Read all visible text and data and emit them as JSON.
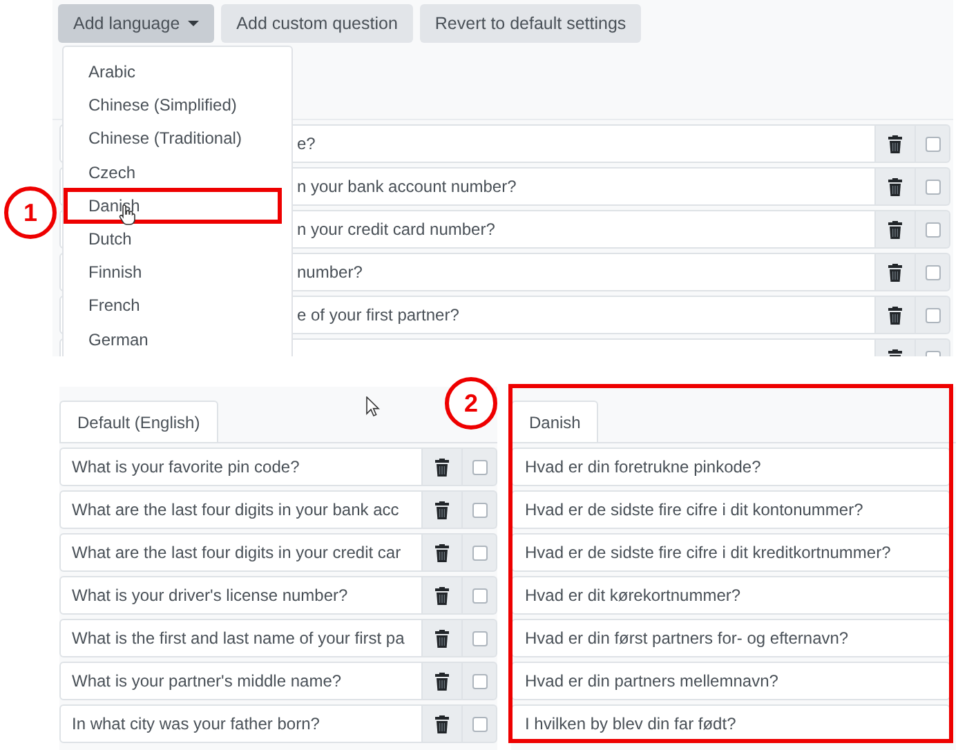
{
  "top_screen": {
    "buttons": [
      {
        "label": "Add language",
        "kind": "dropdown",
        "selected": true
      },
      {
        "label": "Add custom question",
        "kind": "plain",
        "selected": false
      },
      {
        "label": "Revert to default settings",
        "kind": "plain",
        "selected": false
      }
    ],
    "language_menu": {
      "items": [
        {
          "label": "Arabic",
          "selected": false
        },
        {
          "label": "Chinese (Simplified)",
          "selected": false
        },
        {
          "label": "Chinese (Traditional)",
          "selected": false
        },
        {
          "label": "Czech",
          "selected": false
        },
        {
          "label": "Danish",
          "selected": true
        },
        {
          "label": "Dutch",
          "selected": false
        },
        {
          "label": "Finnish",
          "selected": false
        },
        {
          "label": "French",
          "selected": false
        },
        {
          "label": "German",
          "selected": false
        }
      ]
    },
    "rows": [
      {
        "question": "e?",
        "checked": false
      },
      {
        "question": "n your bank account number?",
        "checked": false
      },
      {
        "question": "n your credit card number?",
        "checked": false
      },
      {
        "question": "number?",
        "checked": false
      },
      {
        "question": "e of your first partner?",
        "checked": false
      },
      {
        "checked": false
      }
    ]
  },
  "bottom_screen": {
    "default_panel": {
      "tab": "Default (English)",
      "rows": [
        {
          "question": "What is your favorite pin code?",
          "checked": false
        },
        {
          "question": "What are the last four digits in your bank acc",
          "checked": false
        },
        {
          "question": "What are the last four digits in your credit car",
          "checked": false
        },
        {
          "question": "What is your driver's license number?",
          "checked": false
        },
        {
          "question": "What is the first and last name of your first pa",
          "checked": false
        },
        {
          "question": "What is your partner's middle name?",
          "checked": false
        },
        {
          "question": "In what city was your father born?",
          "checked": false
        }
      ]
    },
    "translation_panel": {
      "tab": "Danish",
      "rows": [
        {
          "question": "Hvad er din foretrukne pinkode?"
        },
        {
          "question": "Hvad er de sidste fire cifre i dit kontonummer?"
        },
        {
          "question": "Hvad er de sidste fire cifre i dit kreditkortnummer?"
        },
        {
          "question": "Hvad er dit kørekortnummer?"
        },
        {
          "question": "Hvad er din først partners for- og efternavn?"
        },
        {
          "question": "Hvad er din partners mellemnavn?"
        },
        {
          "question": "I hvilken by blev din far født?"
        }
      ]
    }
  },
  "annotations": [
    {
      "number": "1"
    },
    {
      "number": "2"
    }
  ]
}
